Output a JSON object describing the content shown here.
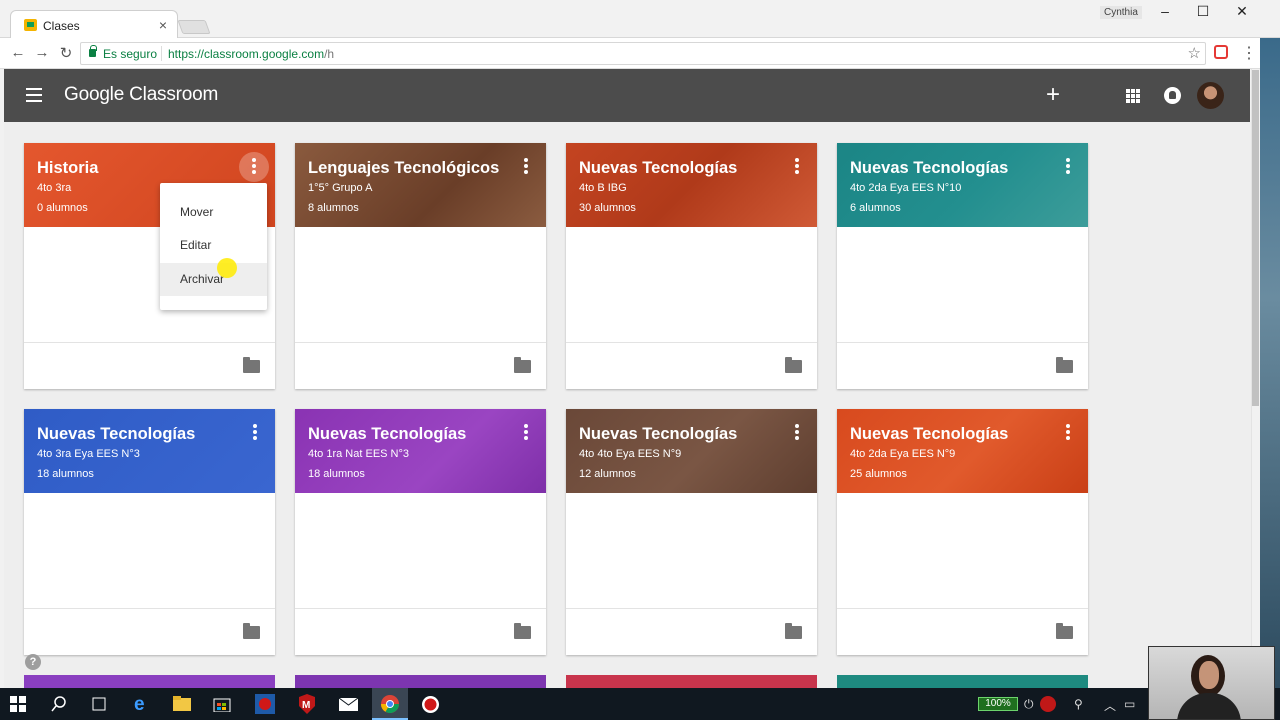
{
  "browser": {
    "tab_title": "Clases",
    "tab_close": "×",
    "profile_name": "Cynthia",
    "secure_label": "Es seguro",
    "url_main": "https://classroom.google.com",
    "url_tail": "/h"
  },
  "app": {
    "brand": "Google Classroom",
    "add_label": "+"
  },
  "cards": [
    {
      "title": "Historia",
      "subtitle": "4to 3ra",
      "count": "0 alumnos",
      "color": "#db4e28"
    },
    {
      "title": "Lenguajes Tecnológicos",
      "subtitle": "1°5° Grupo A",
      "count": "8 alumnos",
      "color": "#7a4a32"
    },
    {
      "title": "Nuevas Tecnologías",
      "subtitle": "4to B IBG",
      "count": "30 alumnos",
      "color": "#c1431f"
    },
    {
      "title": "Nuevas Tecnologías",
      "subtitle": "4to 2da Eya EES N°10",
      "count": "6 alumnos",
      "color": "#1f8a8a"
    },
    {
      "title": "Nuevas Tecnologías",
      "subtitle": "4to 3ra Eya EES N°3",
      "count": "18 alumnos",
      "color": "#3561c8"
    },
    {
      "title": "Nuevas Tecnologías",
      "subtitle": "4to 1ra Nat EES N°3",
      "count": "18 alumnos",
      "color": "#8b35b6"
    },
    {
      "title": "Nuevas Tecnologías",
      "subtitle": "4to 4to Eya EES N°9",
      "count": "12 alumnos",
      "color": "#6b4a38"
    },
    {
      "title": "Nuevas Tecnologías",
      "subtitle": "4to 2da Eya EES N°9",
      "count": "25 alumnos",
      "color": "#dc4a1c"
    }
  ],
  "card_menu": {
    "items": [
      "Mover",
      "Editar",
      "Archivar"
    ]
  },
  "help_label": "?",
  "taskbar": {
    "battery": "100%"
  }
}
